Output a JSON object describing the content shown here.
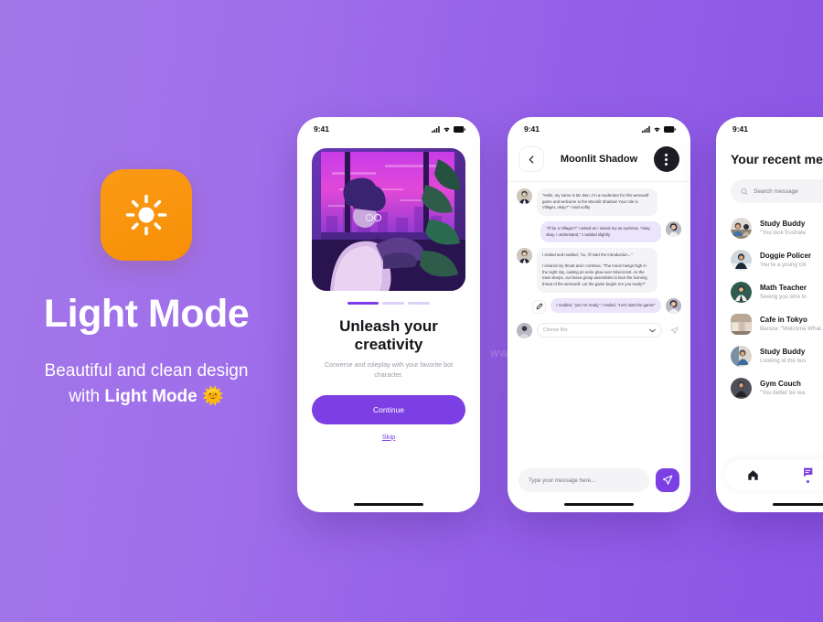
{
  "background": {
    "gradient_from": "#a277e8",
    "gradient_to": "#8b54e6"
  },
  "promo": {
    "icon_name": "sun-icon",
    "icon_bg": "#f78f07",
    "title": "Light Mode",
    "subtitle_line1": "Beautiful and clean design",
    "subtitle_line2_prefix": "with ",
    "subtitle_line2_bold": "Light Mode",
    "subtitle_emoji": "🌞"
  },
  "watermark": "www",
  "status_bar": {
    "time": "9:41",
    "icons": [
      "cellular-icon",
      "wifi-icon",
      "battery-icon"
    ]
  },
  "onboarding": {
    "illustration_alt": "person-sitting-by-window-illustration",
    "dots_total": 3,
    "dots_active_index": 0,
    "title": "Unleash your creativity",
    "description": "Converse and roleplay with your favorite bot character.",
    "continue_label": "Continue",
    "skip_label": "Skip",
    "accent": "#7b3fe4"
  },
  "chat": {
    "back_icon": "arrow-left-icon",
    "title": "Moonlit Shadow",
    "menu_icon": "kebab-menu-icon",
    "messages": [
      {
        "side": "in",
        "avatar": "bot-avatar-man-in-suit",
        "paragraphs": [
          "\"Hello, my name is Mr. Ben, I'm a moderator for this werewolf game and welcome to the Moonlit Shadow! Your role is Villager, okay?\" I said softly."
        ]
      },
      {
        "side": "out",
        "avatar": "user-avatar-woman",
        "paragraphs": [
          "\"I'll be a Villager?\" I asked as I raised my an eyebrow, \"okay, okay, I understand,\" I nodded slightly."
        ]
      },
      {
        "side": "in",
        "avatar": "bot-avatar-man-in-suit",
        "paragraphs": [
          "I smiled and nodded, \"so, I'll start the introduction...\"",
          "I cleared my throat and I continue, \"The moon hangs high in the night sky, casting an eerie glow over Silvercrest. As the town sleeps, our brave group assembles to face the looming threat of the werewolf. Let the game begin! Are you ready?\""
        ]
      },
      {
        "side": "out",
        "avatar": "user-avatar-woman",
        "edit_icon": "pencil-icon",
        "paragraphs": [
          "I nodded, \"yes I'm ready,\" I smiled, \"Let's start the game!\""
        ]
      }
    ],
    "bot_selector": {
      "avatar": "user-avatar-small",
      "value": "Choose Bot",
      "chevron_icon": "chevron-down-icon",
      "send_icon": "send-icon"
    },
    "composer": {
      "placeholder": "Type your message here...",
      "value": "",
      "send_icon": "send-icon",
      "send_bg": "#7b3fe4"
    }
  },
  "messages_list": {
    "title": "Your recent mess",
    "search": {
      "icon": "search-icon",
      "placeholder": "Search message",
      "value": ""
    },
    "items": [
      {
        "avatar": "study-buddy-avatar",
        "avatar_shape": "circle",
        "name": "Study Buddy",
        "preview": "\"You look frustrate"
      },
      {
        "avatar": "doggie-policer-avatar",
        "avatar_shape": "circle",
        "name": "Doggie Policer",
        "preview": "You're a young col"
      },
      {
        "avatar": "math-teacher-avatar",
        "avatar_shape": "circle",
        "name": "Math Teacher",
        "preview": "Seeing you who lo"
      },
      {
        "avatar": "cafe-in-tokyo-avatar",
        "avatar_shape": "square",
        "name": "Cafe in Tokyo",
        "preview": "Barista: \"Welcome What..."
      },
      {
        "avatar": "study-buddy-2-avatar",
        "avatar_shape": "circle",
        "name": "Study Buddy",
        "preview": "Looking at the bus"
      },
      {
        "avatar": "gym-couch-avatar",
        "avatar_shape": "circle",
        "name": "Gym Couch",
        "preview": "\"You better be rea"
      }
    ],
    "tabs": [
      {
        "icon": "home-icon",
        "active": false
      },
      {
        "icon": "chat-icon",
        "active": true
      },
      {
        "icon": "plus-circle-icon",
        "active": false
      }
    ],
    "active_color": "#7b3fe4"
  }
}
